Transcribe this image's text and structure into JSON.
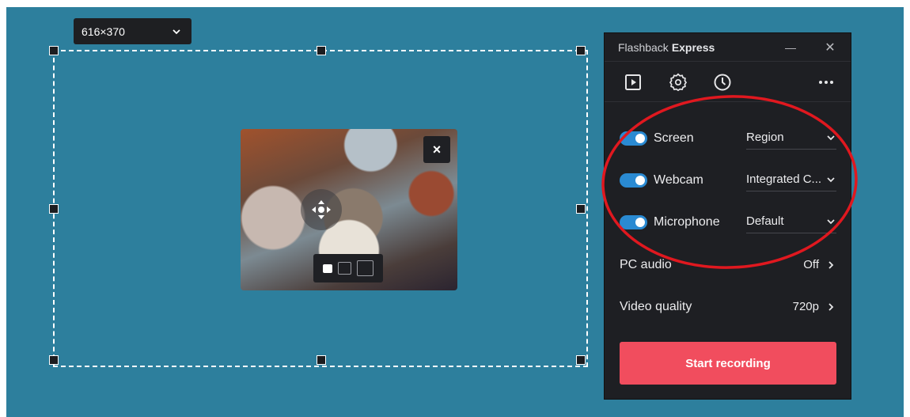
{
  "region_size": {
    "label": "616×370"
  },
  "webcam_preview": {
    "close_label": "×",
    "size_options": [
      "small",
      "medium",
      "large"
    ],
    "selected_size": "small"
  },
  "panel": {
    "title_light": "Flashback",
    "title_bold": "Express",
    "minimize_label": "—",
    "close_label": "✕",
    "tools": [
      "play-icon",
      "settings-gear-icon",
      "history-clock-icon",
      "more-dots-icon"
    ],
    "sources": [
      {
        "label": "Screen",
        "enabled": true,
        "value": "Region"
      },
      {
        "label": "Webcam",
        "enabled": true,
        "value": "Integrated C..."
      },
      {
        "label": "Microphone",
        "enabled": true,
        "value": "Default"
      }
    ],
    "settings": [
      {
        "label": "PC audio",
        "value": "Off"
      },
      {
        "label": "Video quality",
        "value": "720p"
      }
    ],
    "start_button": "Start recording"
  },
  "colors": {
    "desktop": "#2d7f9d",
    "panel": "#1e1f23",
    "toggle_on": "#2a8ad2",
    "start_button": "#f14d5e",
    "annotation": "#e0181f"
  }
}
